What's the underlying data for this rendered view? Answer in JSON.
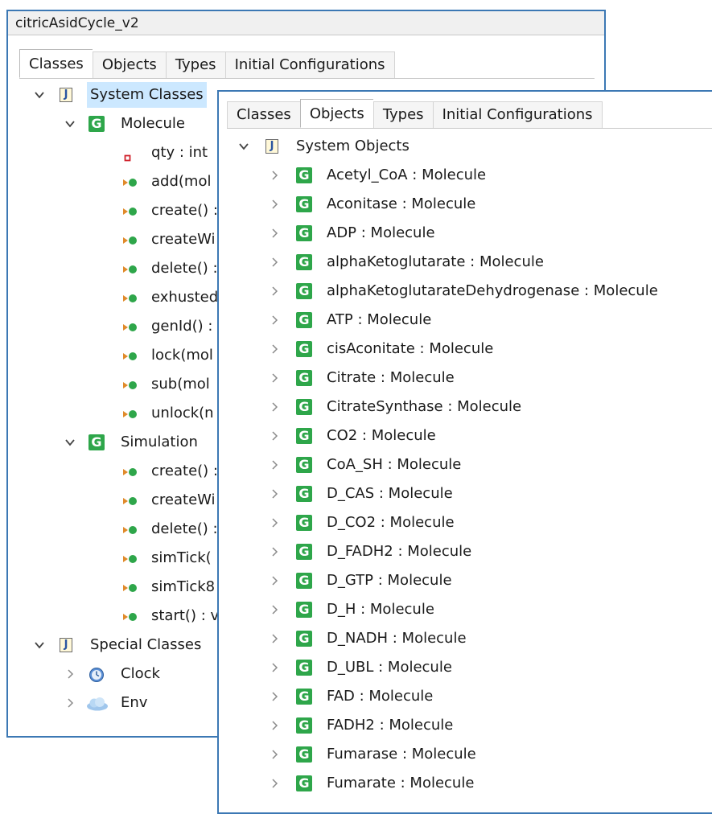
{
  "window": {
    "title": "citricAsidCycle_v2"
  },
  "back_tabs": [
    "Classes",
    "Objects",
    "Types",
    "Initial Configurations"
  ],
  "classes_tree": {
    "root": "System Classes",
    "molecule": {
      "name": "Molecule",
      "members": [
        "qty : int",
        "add(mol",
        "create() :",
        "createWi",
        "delete() :",
        "exhusted",
        "genId() :",
        "lock(mol",
        "sub(mol",
        "unlock(n"
      ]
    },
    "simulation": {
      "name": "Simulation",
      "members": [
        "create() :",
        "createWi",
        "delete() :",
        "simTick(",
        "simTick8",
        "start() : v"
      ]
    },
    "special": {
      "name": "Special Classes",
      "items": [
        "Clock",
        "Env"
      ]
    }
  },
  "front_tabs": [
    "Classes",
    "Objects",
    "Types",
    "Initial Configurations"
  ],
  "objects_tree": {
    "root": "System Objects",
    "items": [
      "Acetyl_CoA : Molecule",
      "Aconitase : Molecule",
      "ADP : Molecule",
      "alphaKetoglutarate : Molecule",
      "alphaKetoglutarateDehydrogenase : Molecule",
      "ATP : Molecule",
      "cisAconitate : Molecule",
      "Citrate : Molecule",
      "CitrateSynthase : Molecule",
      "CO2 : Molecule",
      "CoA_SH : Molecule",
      "D_CAS : Molecule",
      "D_CO2 : Molecule",
      "D_FADH2 : Molecule",
      "D_GTP : Molecule",
      "D_H : Molecule",
      "D_NADH : Molecule",
      "D_UBL : Molecule",
      "FAD : Molecule",
      "FADH2 : Molecule",
      "Fumarase : Molecule",
      "Fumarate : Molecule"
    ]
  },
  "icons": {
    "class": "class-g-icon",
    "package": "package-j-icon",
    "field": "field-square-icon",
    "method": "method-arrow-circle-icon",
    "clock": "clock-icon",
    "env": "cloud-icon"
  },
  "colors": {
    "accent": "#3c78b4",
    "class_icon": "#2ea64a",
    "selection": "#cce8ff"
  }
}
